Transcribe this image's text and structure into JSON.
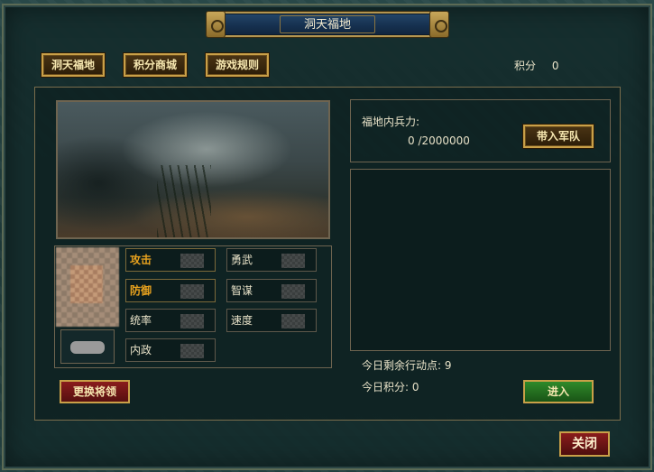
{
  "window": {
    "title": "洞天福地"
  },
  "nav": {
    "dongtian": "洞天福地",
    "shop": "积分商城",
    "rules": "游戏规则"
  },
  "score": {
    "label": "积分",
    "value": "0"
  },
  "general": {
    "stats": [
      {
        "label": "攻击",
        "highlight": true
      },
      {
        "label": "勇武",
        "highlight": false
      },
      {
        "label": "防御",
        "highlight": true
      },
      {
        "label": "智谋",
        "highlight": false
      },
      {
        "label": "统率",
        "highlight": false
      },
      {
        "label": "速度",
        "highlight": false
      },
      {
        "label": "内政",
        "highlight": false
      }
    ],
    "swap_button": "更换将领"
  },
  "troops": {
    "label": "福地内兵力:",
    "value": "0 /2000000",
    "bring_button": "带入军队"
  },
  "daily": {
    "action_points_label": "今日剩余行动点:",
    "action_points": "9",
    "score_label": "今日积分:",
    "score": "0"
  },
  "enter_button": "进入",
  "close_button": "关闭",
  "colors": {
    "gold_border": "#c9a048",
    "highlight_stat": "#e8a21e",
    "red_button": "#8a1c1c",
    "green_button": "#2f8a2a"
  }
}
